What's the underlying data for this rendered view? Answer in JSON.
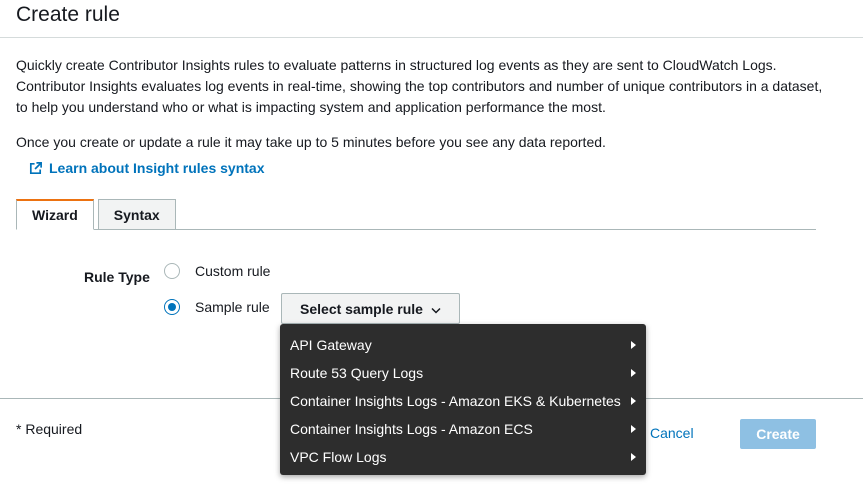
{
  "header": {
    "title": "Create rule"
  },
  "description": {
    "paragraph1": "Quickly create Contributor Insights rules to evaluate patterns in structured log events as they are sent to CloudWatch Logs. Contributor Insights evaluates log events in real-time, showing the top contributors and number of unique contributors in a dataset, to help you understand who or what is impacting system and application performance the most.",
    "paragraph2": "Once you create or update a rule it may take up to 5 minutes before you see any data reported."
  },
  "learn_link": {
    "label": "Learn about Insight rules syntax",
    "icon": "external-link-icon"
  },
  "tabs": [
    {
      "label": "Wizard",
      "active": true
    },
    {
      "label": "Syntax",
      "active": false
    }
  ],
  "form": {
    "rule_type_label": "Rule Type",
    "options": [
      {
        "label": "Custom rule",
        "checked": false
      },
      {
        "label": "Sample rule",
        "checked": true
      }
    ],
    "select_button_label": "Select sample rule"
  },
  "dropdown": {
    "items": [
      "API Gateway",
      "Route 53 Query Logs",
      "Container Insights Logs - Amazon EKS & Kubernetes",
      "Container Insights Logs - Amazon ECS",
      "VPC Flow Logs"
    ]
  },
  "footer": {
    "required_note": "* Required",
    "cancel_label": "Cancel",
    "create_label": "Create"
  },
  "colors": {
    "link": "#0073bb",
    "tab_accent": "#ec7211",
    "primary_disabled": "#8ec0e3",
    "menu_bg": "#2d2d2d"
  }
}
